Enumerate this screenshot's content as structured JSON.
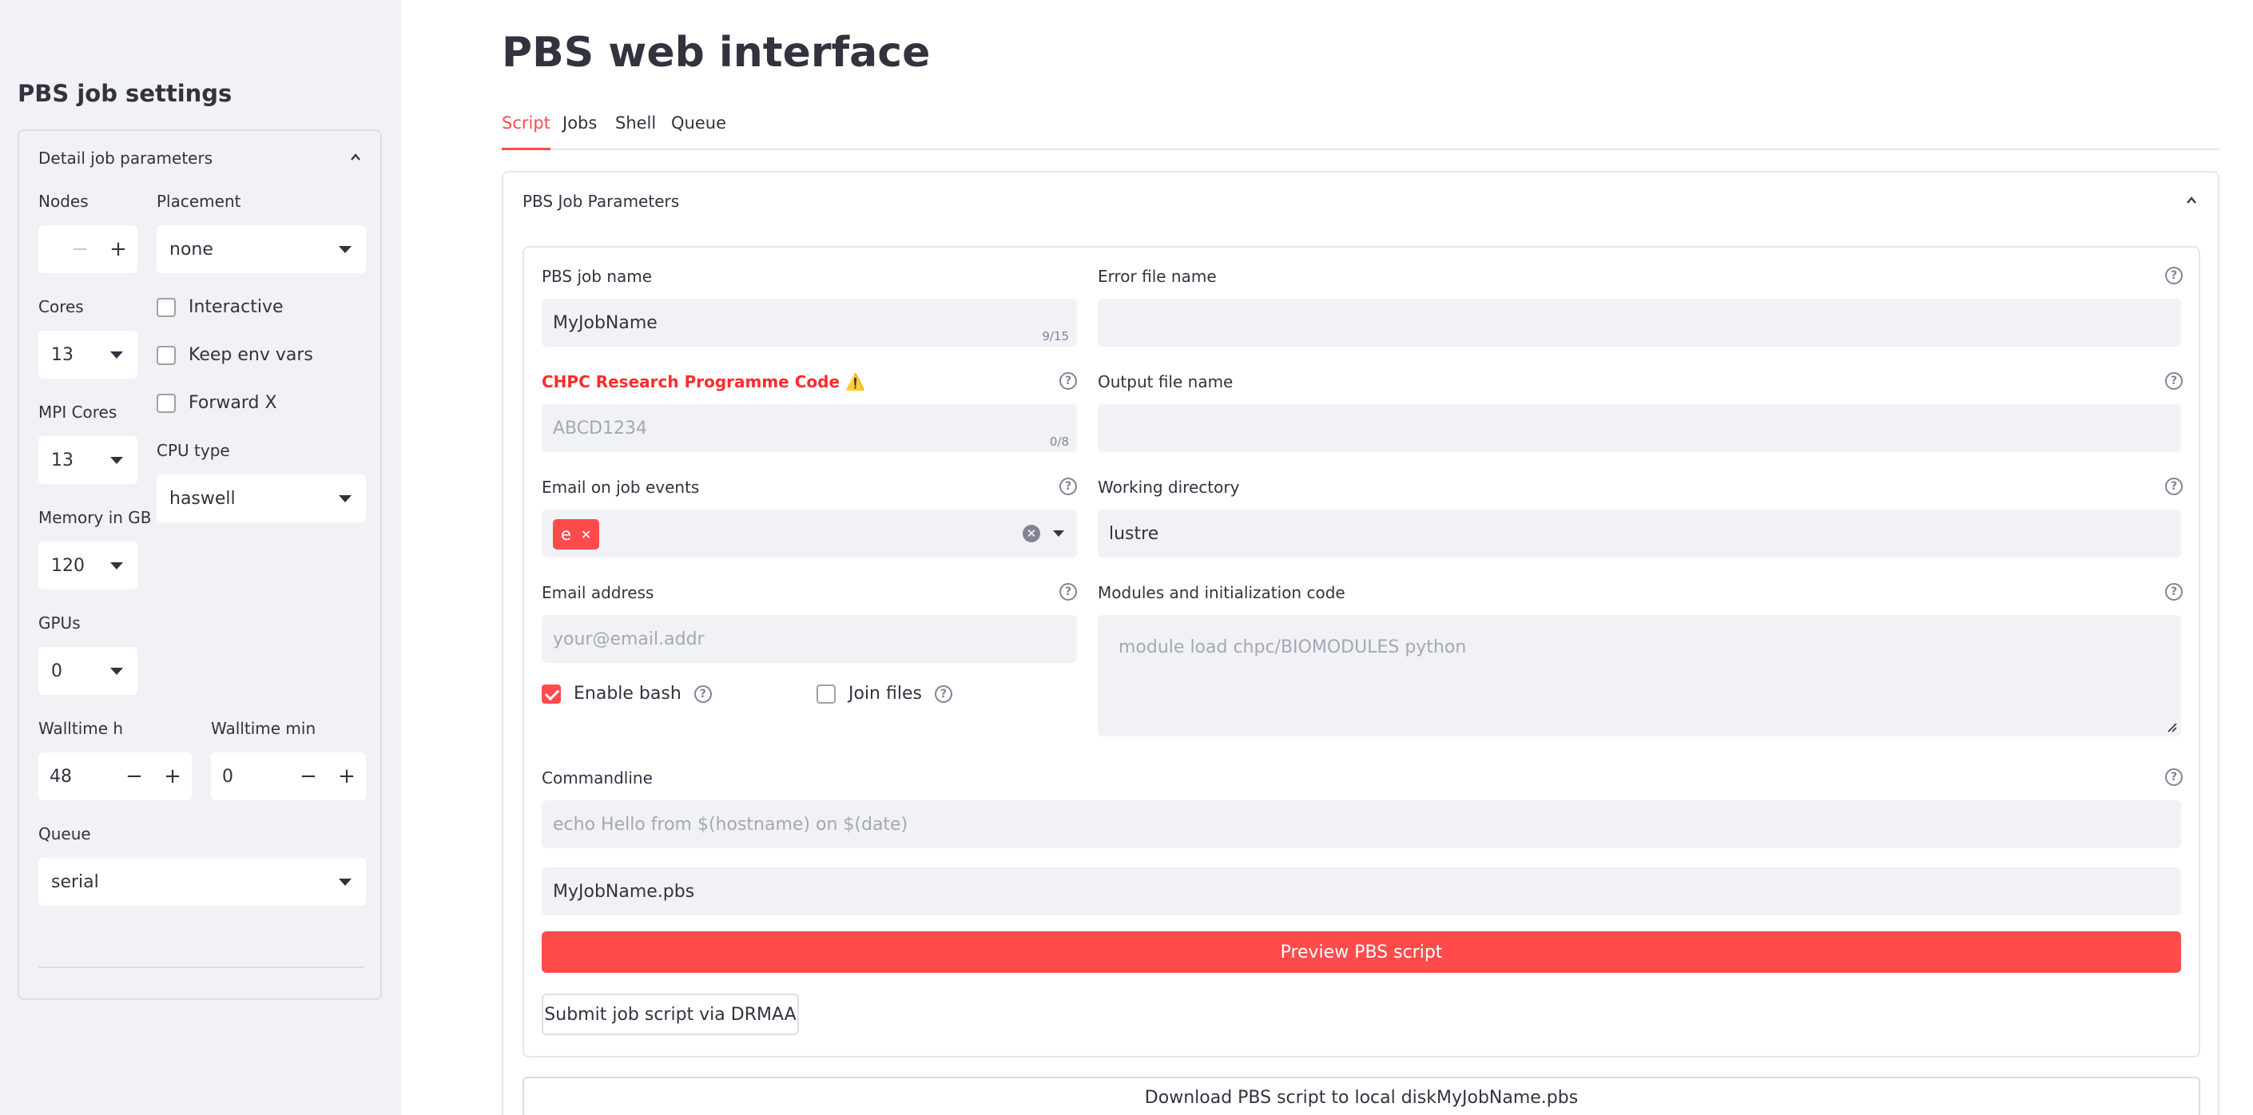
{
  "sidebar": {
    "title": "PBS job settings",
    "panel_title": "Detail job parameters",
    "nodes": {
      "label": "Nodes",
      "value": ""
    },
    "placement": {
      "label": "Placement",
      "value": "none"
    },
    "cores": {
      "label": "Cores",
      "value": "13"
    },
    "mpi_cores": {
      "label": "MPI Cores",
      "value": "13"
    },
    "cpu_type": {
      "label": "CPU type",
      "value": "haswell"
    },
    "memory": {
      "label": "Memory in GB",
      "value": "120"
    },
    "gpus": {
      "label": "GPUs",
      "value": "0"
    },
    "walltime_h": {
      "label": "Walltime h",
      "value": "48"
    },
    "walltime_min": {
      "label": "Walltime min",
      "value": "0"
    },
    "queue": {
      "label": "Queue",
      "value": "serial"
    },
    "checkboxes": {
      "interactive": {
        "label": "Interactive",
        "checked": false
      },
      "keep_env": {
        "label": "Keep env vars",
        "checked": false
      },
      "forward_x": {
        "label": "Forward X",
        "checked": false
      }
    }
  },
  "main": {
    "title": "PBS web interface",
    "tabs": [
      {
        "label": "Script",
        "active": true
      },
      {
        "label": "Jobs",
        "active": false
      },
      {
        "label": "Shell",
        "active": false
      },
      {
        "label": "Queue",
        "active": false
      }
    ],
    "expander_title": "PBS Job Parameters",
    "form": {
      "job_name": {
        "label": "PBS job name",
        "value": "MyJobName",
        "counter": "9/15"
      },
      "error_file": {
        "label": "Error file name",
        "value": ""
      },
      "research_code": {
        "label": "CHPC Research Programme Code",
        "warning": "⚠️",
        "placeholder": "ABCD1234",
        "counter": "0/8"
      },
      "output_file": {
        "label": "Output file name",
        "value": ""
      },
      "email_events": {
        "label": "Email on job events",
        "tags": [
          "e"
        ]
      },
      "working_dir": {
        "label": "Working directory",
        "value": "lustre"
      },
      "email_address": {
        "label": "Email address",
        "placeholder": "your@email.addr"
      },
      "modules": {
        "label": "Modules and initialization code",
        "placeholder": "module load chpc/BIOMODULES python"
      },
      "enable_bash": {
        "label": "Enable bash",
        "checked": true
      },
      "join_files": {
        "label": "Join files",
        "checked": false
      },
      "commandline": {
        "label": "Commandline",
        "placeholder": "echo Hello from $(hostname) on $(date)"
      },
      "script_filename": {
        "value": "MyJobName.pbs"
      },
      "preview_button": "Preview PBS script",
      "submit_button": "Submit job script via DRMAA"
    },
    "download_button": "Download PBS script to local diskMyJobName.pbs"
  },
  "colors": {
    "accent": "#ff4b4b",
    "sidebar_bg": "#f0f2f6",
    "input_bg": "#f0f2f6",
    "text": "#31333f"
  },
  "icons": {
    "help": "?",
    "minus": "−",
    "plus": "+",
    "tag_close": "✕",
    "clear": "✕"
  }
}
